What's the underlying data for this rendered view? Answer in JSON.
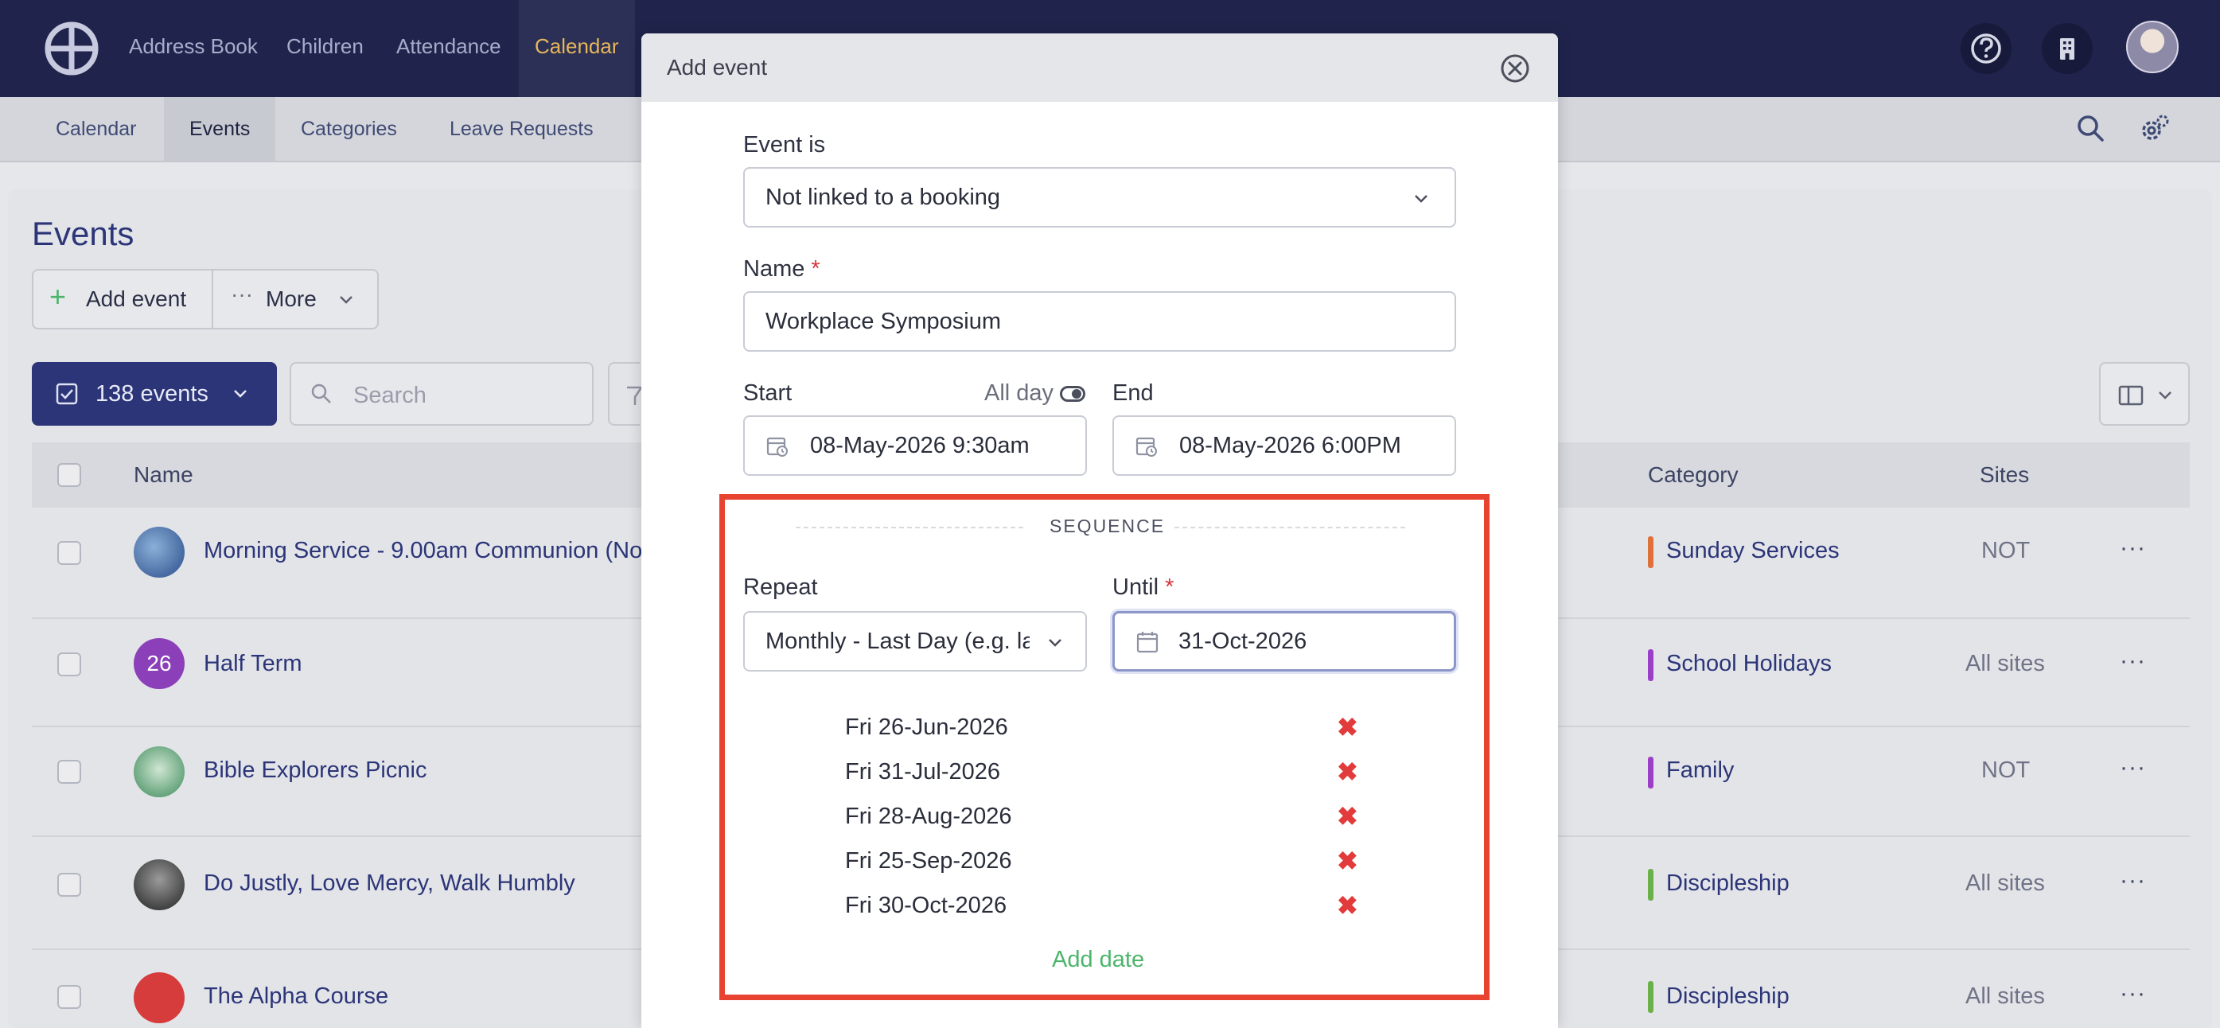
{
  "topnav": {
    "items": [
      "Address Book",
      "Children",
      "Attendance",
      "Calendar"
    ],
    "active": "Calendar",
    "help_icon": "question-circle-icon",
    "building_icon": "building-icon"
  },
  "subnav": {
    "items": [
      "Calendar",
      "Events",
      "Categories",
      "Leave Requests"
    ],
    "active": "Events"
  },
  "page": {
    "title": "Events",
    "add_event_label": "Add event",
    "more_label": "More",
    "events_count_label": "138 events",
    "search_placeholder": "Search"
  },
  "table": {
    "headers": {
      "name": "Name",
      "category": "Category",
      "sites": "Sites"
    },
    "rows": [
      {
        "name": "Morning Service - 9.00am Communion (No",
        "avatar": "",
        "category": "Sunday Services",
        "cat_color": "#e0703a",
        "sites": "NOT"
      },
      {
        "name": "Half Term",
        "avatar": "26",
        "category": "School Holidays",
        "cat_color": "#9b3fc8",
        "sites": "All sites"
      },
      {
        "name": "Bible Explorers Picnic",
        "avatar": "",
        "category": "Family",
        "cat_color": "#9b3fc8",
        "sites": "NOT"
      },
      {
        "name": "Do Justly, Love Mercy, Walk Humbly",
        "avatar": "",
        "category": "Discipleship",
        "cat_color": "#6cb04a",
        "sites": "All sites"
      },
      {
        "name": "The Alpha Course",
        "avatar": "",
        "category": "Discipleship",
        "cat_color": "#6cb04a",
        "sites": "All sites"
      }
    ]
  },
  "modal": {
    "title": "Add event",
    "event_is_label": "Event is",
    "event_is_value": "Not linked to a booking",
    "name_label": "Name",
    "required_mark": "*",
    "name_value": "Workplace Symposium",
    "start_label": "Start",
    "all_day_label": "All day",
    "end_label": "End",
    "start_value": "08-May-2026 9:30am",
    "end_value": "08-May-2026 6:00PM",
    "sequence_title": "SEQUENCE",
    "repeat_label": "Repeat",
    "repeat_value": "Monthly - Last Day (e.g. last Friday)",
    "until_label": "Until",
    "until_value": "31-Oct-2026",
    "dates": [
      "Fri 26-Jun-2026",
      "Fri 31-Jul-2026",
      "Fri 28-Aug-2026",
      "Fri 25-Sep-2026",
      "Fri 30-Oct-2026"
    ],
    "delete_mark": "✖",
    "add_date_label": "Add date"
  },
  "colors": {
    "nav_bg": "#20244c",
    "accent": "#2b3578",
    "active_nav": "#e6b65a",
    "highlight_border": "#e84330",
    "delete_red": "#e23b3b",
    "add_green": "#4cb56b"
  }
}
